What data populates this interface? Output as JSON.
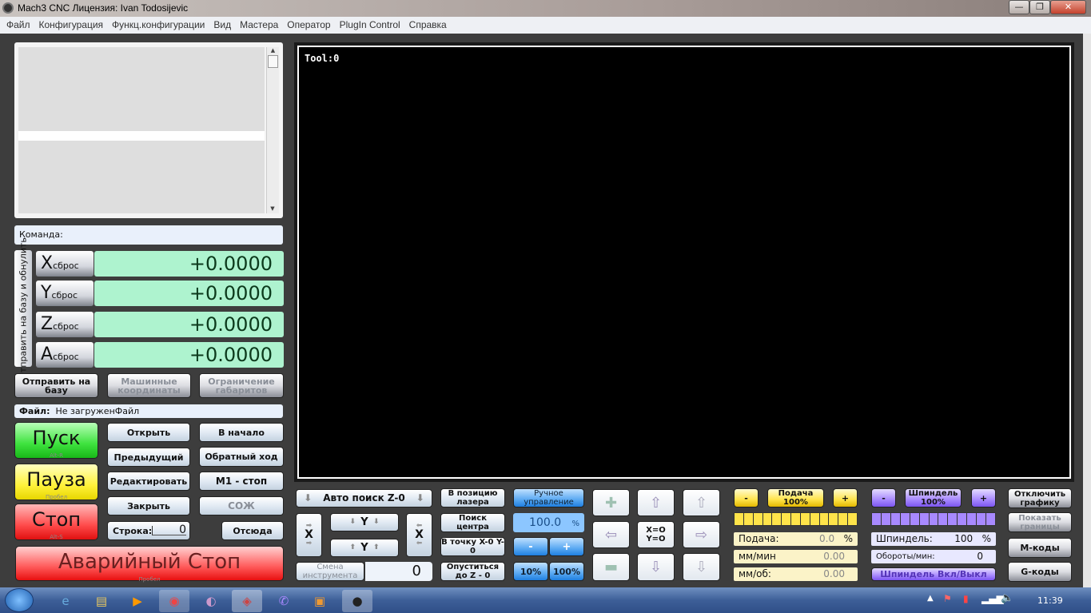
{
  "window": {
    "title": "Mach3 CNC  Лицензия: Ivan Todosijevic",
    "controls": [
      "—",
      "❐",
      "✕"
    ]
  },
  "menu": [
    "Файл",
    "Конфигурация",
    "Функц.конфигурации",
    "Вид",
    "Мастера",
    "Оператор",
    "PlugIn Control",
    "Справка"
  ],
  "command_label": "Команда:",
  "ref_all_label": "Отправить на базу и обнулить",
  "dro": [
    {
      "axis": "X",
      "reset": "сброс",
      "value": "+0.0000"
    },
    {
      "axis": "Y",
      "reset": "сброс",
      "value": "+0.0000"
    },
    {
      "axis": "Z",
      "reset": "сброс",
      "value": "+0.0000"
    },
    {
      "axis": "A",
      "reset": "сброс",
      "value": "+0.0000"
    }
  ],
  "row_buttons": {
    "home": "Отправить на базу",
    "machine": "Машинные координаты",
    "limits": "Ограничение габаритов"
  },
  "file": {
    "label": "Файл:",
    "value": "Не загруженФайл"
  },
  "cycle": {
    "start": "Пуск",
    "start_key": "Alt-R",
    "pause": "Пауза",
    "pause_key": "Пробел",
    "stop": "Стоп",
    "stop_key": "Alt-S",
    "estop": "Аварийный Стоп",
    "estop_key": "Пробел"
  },
  "file_buttons": {
    "open": "Открыть",
    "rewind": "В начало",
    "prev": "Предыдущий",
    "reverse": "Обратный ход",
    "edit": "Редактировать",
    "m1": "M1 - стоп",
    "close": "Закрыть",
    "coolant": "СОЖ",
    "line_label": "Строка:",
    "line_value": "0",
    "from_here": "Отсюда"
  },
  "toolpath": {
    "tool_label": "Tool:0"
  },
  "probe": {
    "auto_z": "Авто поиск Z-0",
    "x": "X",
    "y": "Y",
    "tool_change": "Смена инструмента",
    "tool_value": "0"
  },
  "center_buttons": {
    "laser": "В позицию лазера",
    "find_center": "Поиск центра",
    "goto_zero": "В точку X-0 Y-0",
    "lower_z": "Опуститься до Z - 0"
  },
  "jog": {
    "manual": "Ручное управление",
    "rate": "100.0",
    "rate_unit": "%",
    "minus": "-",
    "plus": "+",
    "p10": "10%",
    "p100": "100%",
    "zero_xy": "X=O Y=O",
    "icons": [
      "a-plus",
      "y-plus",
      "z-plus",
      "x-minus",
      "zero",
      "x-plus",
      "a-minus",
      "y-minus",
      "z-minus"
    ]
  },
  "feed": {
    "minus": "-",
    "label": "Подача 100%",
    "plus": "+",
    "feed_label": "Подача:",
    "feed_value": "0.0",
    "feed_unit": "%",
    "mm_min_label": "мм/мин",
    "mm_min_value": "0.00",
    "mm_rev_label": "мм/об:",
    "mm_rev_value": "0.00",
    "override_percent": 100,
    "color": "#ffe44a"
  },
  "spindle": {
    "minus": "-",
    "label": "Шпиндель 100%",
    "plus": "+",
    "sp_label": "Шпиндель:",
    "sp_value": "100",
    "sp_unit": "%",
    "rpm_label": "Обороты/мин:",
    "rpm_value": "0",
    "toggle": "Шпиндель Вкл/Выкл",
    "override_percent": 100,
    "color": "#a889ff"
  },
  "side_buttons": {
    "disable_graphics": "Отключить графику",
    "show_limits": "Показать границы",
    "mcodes": "M-коды",
    "gcodes": "G-коды"
  },
  "taskbar": {
    "clock": "11:39",
    "apps": [
      "ie-icon",
      "explorer-icon",
      "media-icon",
      "chrome-icon",
      "app-icon",
      "mach3-icon",
      "viber-icon",
      "package-icon",
      "camera-icon"
    ]
  }
}
